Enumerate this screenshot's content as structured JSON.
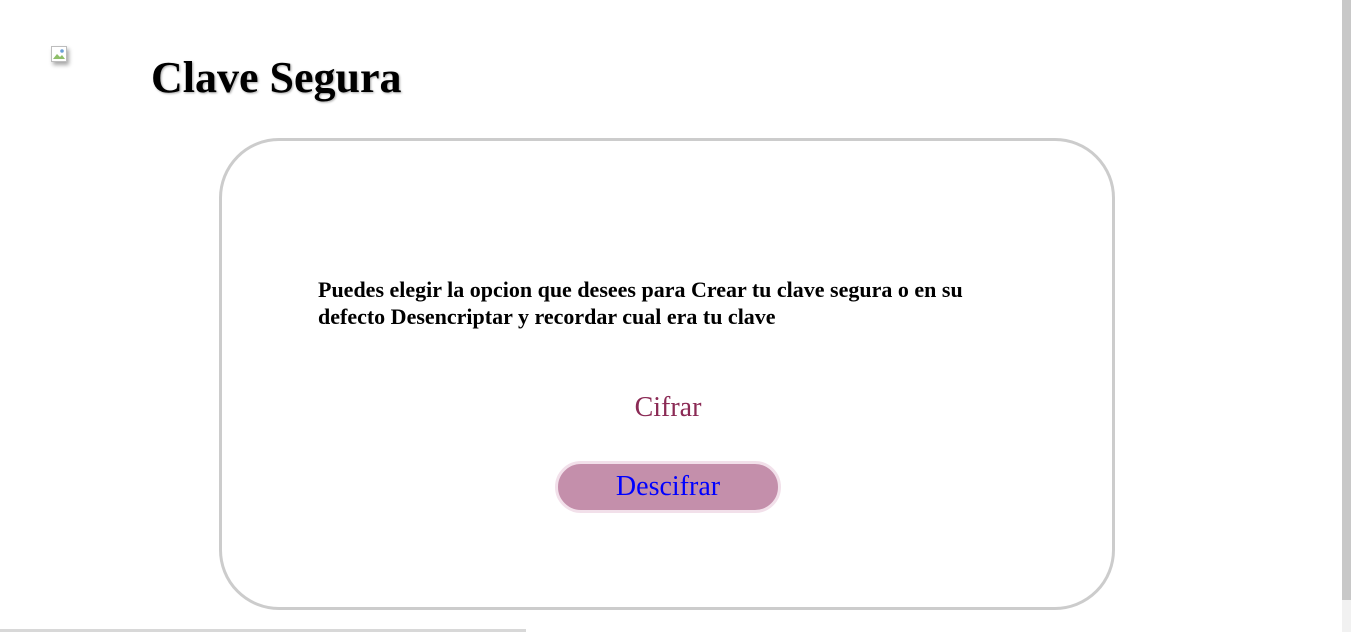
{
  "header": {
    "logo_icon": "broken-image-icon",
    "title": "Clave Segura"
  },
  "card": {
    "description": "Puedes elegir la opcion que desees para Crear tu clave segura o en su defecto Desencriptar y recordar cual era tu clave",
    "cifrar_label": "Cifrar",
    "descifrar_label": "Descifrar"
  },
  "colors": {
    "card_border": "#cccccc",
    "cifrar_text": "#8b2a55",
    "descifrar_bg": "#c48fab",
    "descifrar_text": "#0000ff"
  }
}
